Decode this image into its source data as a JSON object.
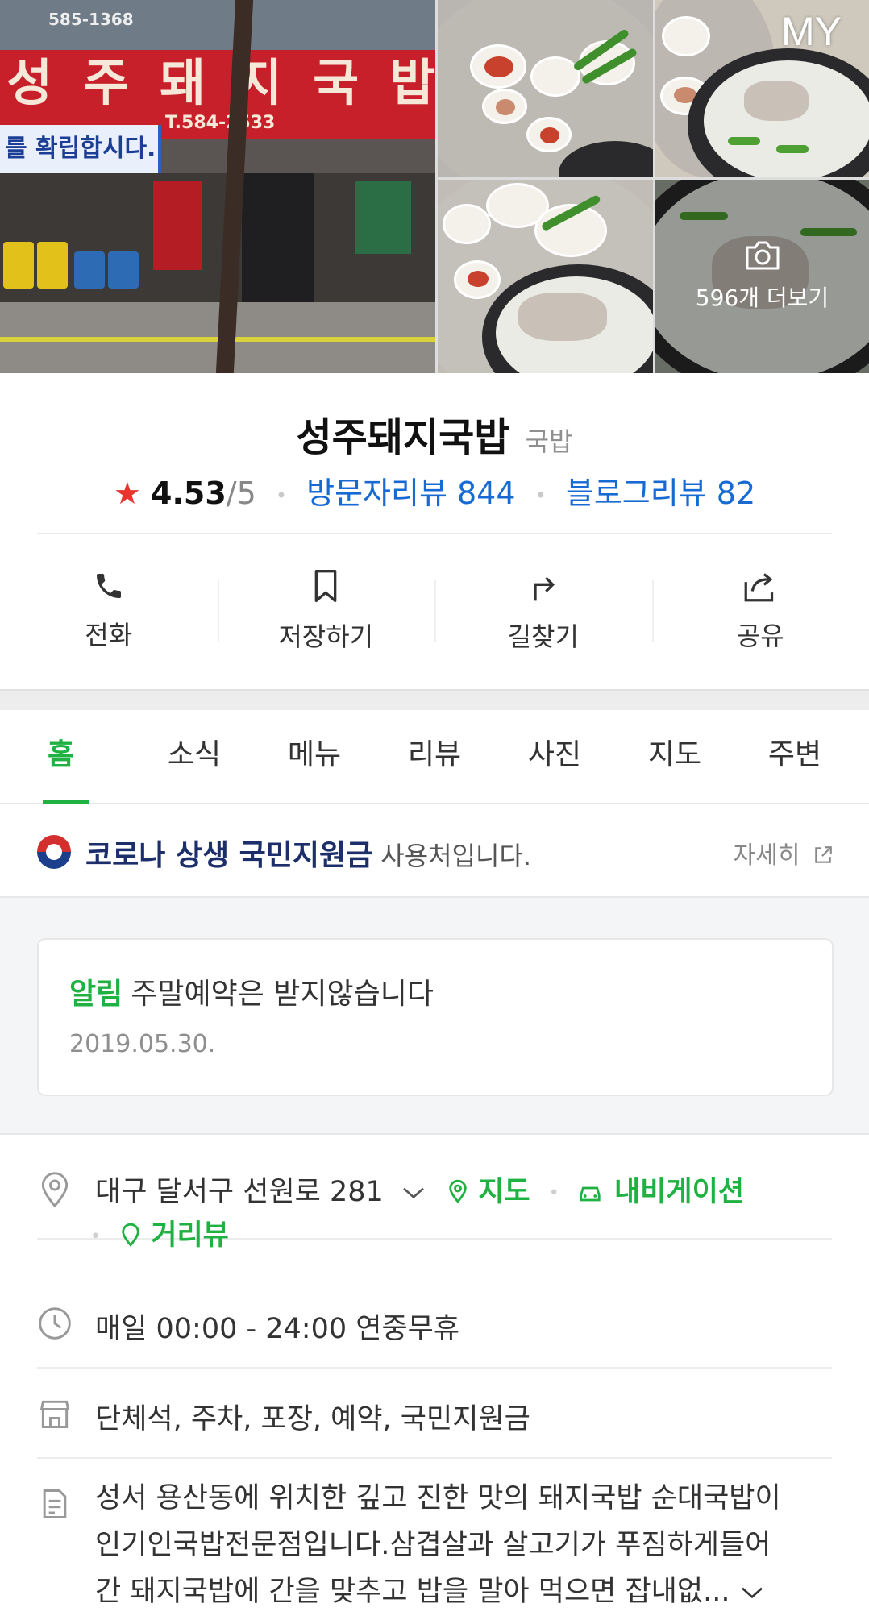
{
  "header": {
    "my_label": "MY",
    "photo_more": "596개 더보기",
    "storefront": {
      "sign": "성주돼지국밥",
      "tel": "T.584-2533",
      "banner": "를 확립합시다.",
      "top_tel": "585-1368"
    }
  },
  "place": {
    "name": "성주돼지국밥",
    "category": "국밥",
    "rating": "4.53",
    "rating_max": "/5",
    "visitor_reviews": "방문자리뷰 844",
    "blog_reviews": "블로그리뷰 82"
  },
  "actions": [
    {
      "label": "전화",
      "icon": "phone-icon"
    },
    {
      "label": "저장하기",
      "icon": "bookmark-icon"
    },
    {
      "label": "길찾기",
      "icon": "directions-icon"
    },
    {
      "label": "공유",
      "icon": "share-icon"
    }
  ],
  "tabs": [
    {
      "label": "홈",
      "active": true
    },
    {
      "label": "소식"
    },
    {
      "label": "메뉴"
    },
    {
      "label": "리뷰"
    },
    {
      "label": "사진"
    },
    {
      "label": "지도"
    },
    {
      "label": "주변"
    }
  ],
  "corona": {
    "title": "코로나 상생 국민지원금",
    "subtitle": "사용처입니다.",
    "more": "자세히"
  },
  "notice": {
    "tag": "알림",
    "text": "주말예약은 받지않습니다",
    "date": "2019.05.30."
  },
  "info": {
    "address": "대구 달서구 선원로 281",
    "map_link": "지도",
    "nav_link": "내비게이션",
    "streetview_link": "거리뷰",
    "hours": "매일 00:00 - 24:00 연중무휴",
    "amenities": "단체석, 주차, 포장, 예약, 국민지원금",
    "description_lines": [
      "성서 용산동에 위치한 깊고 진한 맛의 돼지국밥 순대국밥이",
      "인기인국밥전문점입니다.삼겹살과 살고기가 푸짐하게들어",
      "간 돼지국밥에 간을 맞추고 밥을 말아 먹으면 잡내없..."
    ]
  },
  "colors": {
    "accent_green": "#1fb141",
    "link_blue": "#176ad4",
    "star_red": "#e8352e"
  }
}
